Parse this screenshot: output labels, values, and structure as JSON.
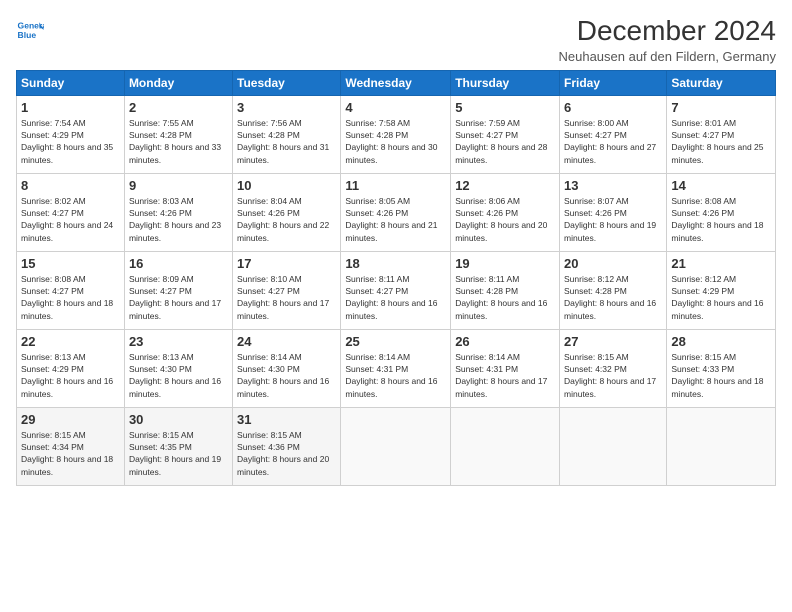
{
  "header": {
    "logo_line1": "General",
    "logo_line2": "Blue",
    "month": "December 2024",
    "location": "Neuhausen auf den Fildern, Germany"
  },
  "weekdays": [
    "Sunday",
    "Monday",
    "Tuesday",
    "Wednesday",
    "Thursday",
    "Friday",
    "Saturday"
  ],
  "weeks": [
    [
      {
        "day": "1",
        "sunrise": "Sunrise: 7:54 AM",
        "sunset": "Sunset: 4:29 PM",
        "daylight": "Daylight: 8 hours and 35 minutes."
      },
      {
        "day": "2",
        "sunrise": "Sunrise: 7:55 AM",
        "sunset": "Sunset: 4:28 PM",
        "daylight": "Daylight: 8 hours and 33 minutes."
      },
      {
        "day": "3",
        "sunrise": "Sunrise: 7:56 AM",
        "sunset": "Sunset: 4:28 PM",
        "daylight": "Daylight: 8 hours and 31 minutes."
      },
      {
        "day": "4",
        "sunrise": "Sunrise: 7:58 AM",
        "sunset": "Sunset: 4:28 PM",
        "daylight": "Daylight: 8 hours and 30 minutes."
      },
      {
        "day": "5",
        "sunrise": "Sunrise: 7:59 AM",
        "sunset": "Sunset: 4:27 PM",
        "daylight": "Daylight: 8 hours and 28 minutes."
      },
      {
        "day": "6",
        "sunrise": "Sunrise: 8:00 AM",
        "sunset": "Sunset: 4:27 PM",
        "daylight": "Daylight: 8 hours and 27 minutes."
      },
      {
        "day": "7",
        "sunrise": "Sunrise: 8:01 AM",
        "sunset": "Sunset: 4:27 PM",
        "daylight": "Daylight: 8 hours and 25 minutes."
      }
    ],
    [
      {
        "day": "8",
        "sunrise": "Sunrise: 8:02 AM",
        "sunset": "Sunset: 4:27 PM",
        "daylight": "Daylight: 8 hours and 24 minutes."
      },
      {
        "day": "9",
        "sunrise": "Sunrise: 8:03 AM",
        "sunset": "Sunset: 4:26 PM",
        "daylight": "Daylight: 8 hours and 23 minutes."
      },
      {
        "day": "10",
        "sunrise": "Sunrise: 8:04 AM",
        "sunset": "Sunset: 4:26 PM",
        "daylight": "Daylight: 8 hours and 22 minutes."
      },
      {
        "day": "11",
        "sunrise": "Sunrise: 8:05 AM",
        "sunset": "Sunset: 4:26 PM",
        "daylight": "Daylight: 8 hours and 21 minutes."
      },
      {
        "day": "12",
        "sunrise": "Sunrise: 8:06 AM",
        "sunset": "Sunset: 4:26 PM",
        "daylight": "Daylight: 8 hours and 20 minutes."
      },
      {
        "day": "13",
        "sunrise": "Sunrise: 8:07 AM",
        "sunset": "Sunset: 4:26 PM",
        "daylight": "Daylight: 8 hours and 19 minutes."
      },
      {
        "day": "14",
        "sunrise": "Sunrise: 8:08 AM",
        "sunset": "Sunset: 4:26 PM",
        "daylight": "Daylight: 8 hours and 18 minutes."
      }
    ],
    [
      {
        "day": "15",
        "sunrise": "Sunrise: 8:08 AM",
        "sunset": "Sunset: 4:27 PM",
        "daylight": "Daylight: 8 hours and 18 minutes."
      },
      {
        "day": "16",
        "sunrise": "Sunrise: 8:09 AM",
        "sunset": "Sunset: 4:27 PM",
        "daylight": "Daylight: 8 hours and 17 minutes."
      },
      {
        "day": "17",
        "sunrise": "Sunrise: 8:10 AM",
        "sunset": "Sunset: 4:27 PM",
        "daylight": "Daylight: 8 hours and 17 minutes."
      },
      {
        "day": "18",
        "sunrise": "Sunrise: 8:11 AM",
        "sunset": "Sunset: 4:27 PM",
        "daylight": "Daylight: 8 hours and 16 minutes."
      },
      {
        "day": "19",
        "sunrise": "Sunrise: 8:11 AM",
        "sunset": "Sunset: 4:28 PM",
        "daylight": "Daylight: 8 hours and 16 minutes."
      },
      {
        "day": "20",
        "sunrise": "Sunrise: 8:12 AM",
        "sunset": "Sunset: 4:28 PM",
        "daylight": "Daylight: 8 hours and 16 minutes."
      },
      {
        "day": "21",
        "sunrise": "Sunrise: 8:12 AM",
        "sunset": "Sunset: 4:29 PM",
        "daylight": "Daylight: 8 hours and 16 minutes."
      }
    ],
    [
      {
        "day": "22",
        "sunrise": "Sunrise: 8:13 AM",
        "sunset": "Sunset: 4:29 PM",
        "daylight": "Daylight: 8 hours and 16 minutes."
      },
      {
        "day": "23",
        "sunrise": "Sunrise: 8:13 AM",
        "sunset": "Sunset: 4:30 PM",
        "daylight": "Daylight: 8 hours and 16 minutes."
      },
      {
        "day": "24",
        "sunrise": "Sunrise: 8:14 AM",
        "sunset": "Sunset: 4:30 PM",
        "daylight": "Daylight: 8 hours and 16 minutes."
      },
      {
        "day": "25",
        "sunrise": "Sunrise: 8:14 AM",
        "sunset": "Sunset: 4:31 PM",
        "daylight": "Daylight: 8 hours and 16 minutes."
      },
      {
        "day": "26",
        "sunrise": "Sunrise: 8:14 AM",
        "sunset": "Sunset: 4:31 PM",
        "daylight": "Daylight: 8 hours and 17 minutes."
      },
      {
        "day": "27",
        "sunrise": "Sunrise: 8:15 AM",
        "sunset": "Sunset: 4:32 PM",
        "daylight": "Daylight: 8 hours and 17 minutes."
      },
      {
        "day": "28",
        "sunrise": "Sunrise: 8:15 AM",
        "sunset": "Sunset: 4:33 PM",
        "daylight": "Daylight: 8 hours and 18 minutes."
      }
    ],
    [
      {
        "day": "29",
        "sunrise": "Sunrise: 8:15 AM",
        "sunset": "Sunset: 4:34 PM",
        "daylight": "Daylight: 8 hours and 18 minutes."
      },
      {
        "day": "30",
        "sunrise": "Sunrise: 8:15 AM",
        "sunset": "Sunset: 4:35 PM",
        "daylight": "Daylight: 8 hours and 19 minutes."
      },
      {
        "day": "31",
        "sunrise": "Sunrise: 8:15 AM",
        "sunset": "Sunset: 4:36 PM",
        "daylight": "Daylight: 8 hours and 20 minutes."
      },
      null,
      null,
      null,
      null
    ]
  ]
}
